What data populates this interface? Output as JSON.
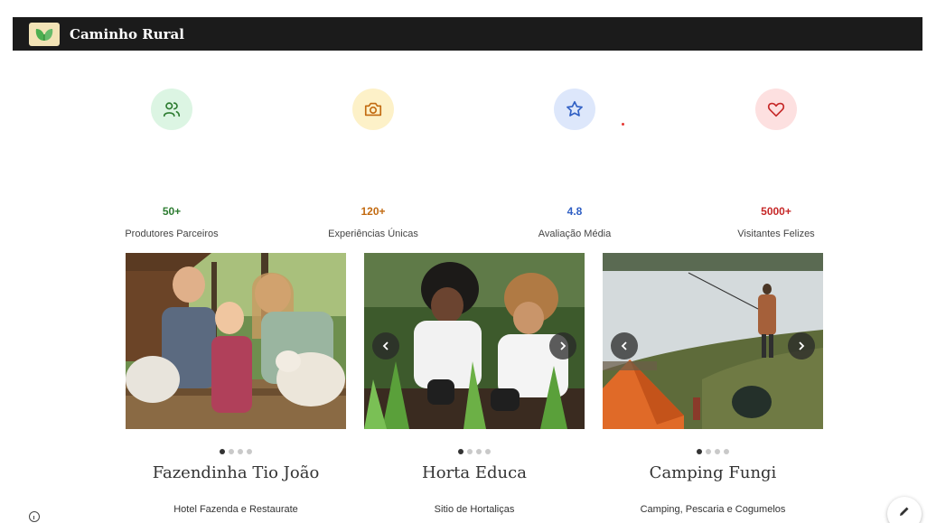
{
  "header": {
    "brand": "Caminho Rural",
    "logo_icon": "leaf-logo-icon"
  },
  "stats": [
    {
      "value": "50+",
      "label": "Produtores Parceiros",
      "icon": "users-icon",
      "color": "#2e7d32",
      "bg": "#dcf5e3"
    },
    {
      "value": "120+",
      "label": "Experiências Únicas",
      "icon": "camera-icon",
      "color": "#c26a10",
      "bg": "#fdf1c8"
    },
    {
      "value": "4.8",
      "label": "Avaliação Média",
      "icon": "star-icon",
      "color": "#2f5fc4",
      "bg": "#dde7fb"
    },
    {
      "value": "5000+",
      "label": "Visitantes Felizes",
      "icon": "heart-icon",
      "color": "#c62828",
      "bg": "#fde0e0"
    }
  ],
  "cards": [
    {
      "title": "Fazendinha Tio João",
      "subtitle": "Hotel Fazenda e Restaurate",
      "slide_count": 4,
      "active_slide": 1
    },
    {
      "title": "Horta Educa",
      "subtitle": "Sitio de Hortaliças",
      "slide_count": 4,
      "active_slide": 1
    },
    {
      "title": "Camping Fungi",
      "subtitle": "Camping, Pescaria e Cogumelos",
      "slide_count": 4,
      "active_slide": 1
    }
  ],
  "colors": {
    "header_bg": "#1b1b1b",
    "accent_red": "#e53935"
  }
}
